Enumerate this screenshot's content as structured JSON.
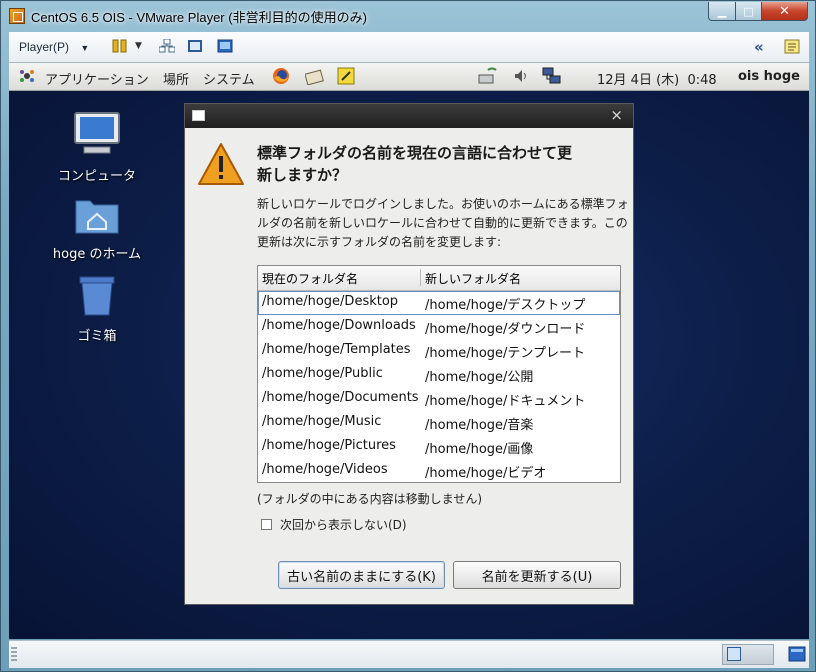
{
  "window": {
    "title": "CentOS 6.5 OIS - VMware Player (非営利目的の使用のみ)",
    "caption_min": "▁",
    "caption_max": "□",
    "caption_close": "✕"
  },
  "vm_toolbar": {
    "player_menu": "Player(P)",
    "collapse_glyph": "«"
  },
  "gnome_panel": {
    "applications": "アプリケーション",
    "places": "場所",
    "system": "システム",
    "clock": "12月 4日 (木)  0:48",
    "user": "ois hoge"
  },
  "desktop": {
    "icons": [
      {
        "label": "コンピュータ",
        "icon": "computer-icon"
      },
      {
        "label": "hoge のホーム",
        "icon": "home-folder-icon"
      },
      {
        "label": "ゴミ箱",
        "icon": "trash-icon"
      }
    ]
  },
  "dialog": {
    "close_glyph": "×",
    "heading": "標準フォルダの名前を現在の言語に合わせて更新しますか？",
    "body": "新しいロケールでログインしました。お使いのホームにある標準フォルダの名前を新しいロケールに合わせて自動的に更新できます。この更新は次に示すフォルダの名前を変更します:",
    "columns": [
      "現在のフォルダ名",
      "新しいフォルダ名"
    ],
    "rows": [
      [
        "/home/hoge/Desktop",
        "/home/hoge/デスクトップ"
      ],
      [
        "/home/hoge/Downloads",
        "/home/hoge/ダウンロード"
      ],
      [
        "/home/hoge/Templates",
        "/home/hoge/テンプレート"
      ],
      [
        "/home/hoge/Public",
        "/home/hoge/公開"
      ],
      [
        "/home/hoge/Documents",
        "/home/hoge/ドキュメント"
      ],
      [
        "/home/hoge/Music",
        "/home/hoge/音楽"
      ],
      [
        "/home/hoge/Pictures",
        "/home/hoge/画像"
      ],
      [
        "/home/hoge/Videos",
        "/home/hoge/ビデオ"
      ]
    ],
    "note": "(フォルダの中にある内容は移動しません)",
    "checkbox_label": "次回から表示しない(D)",
    "checkbox_checked": false,
    "keep_button": "古い名前のままにする(K)",
    "update_button": "名前を更新する(U)"
  },
  "colors": {
    "desktop_bg": "#0d1f4a",
    "warning": "#f0a020"
  }
}
